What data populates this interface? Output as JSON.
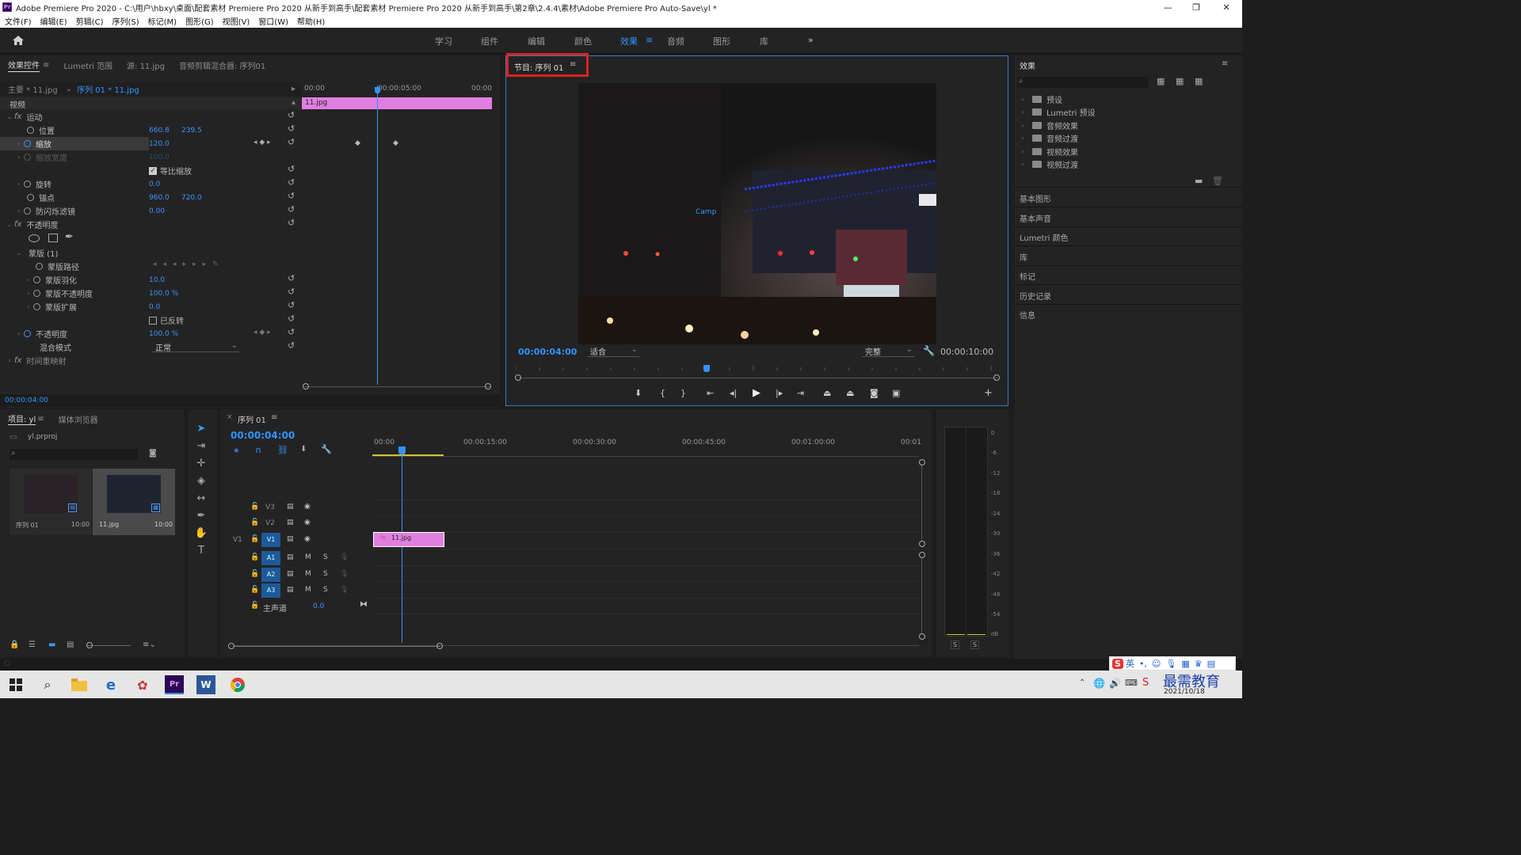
{
  "app": {
    "title": "Adobe Premiere Pro 2020 - C:\\用户\\hbxy\\桌面\\配套素材 Premiere Pro 2020 从新手到高手\\配套素材 Premiere Pro 2020 从新手到高手\\第2章\\2.4.4\\素材\\Adobe Premiere Pro Auto-Save\\yl *",
    "logo": "Pr"
  },
  "menu": [
    "文件(F)",
    "编辑(E)",
    "剪辑(C)",
    "序列(S)",
    "标记(M)",
    "图形(G)",
    "视图(V)",
    "窗口(W)",
    "帮助(H)"
  ],
  "workspaces": [
    "学习",
    "组件",
    "编辑",
    "颜色",
    "效果",
    "音频",
    "图形",
    "库"
  ],
  "workspaces_more": "»",
  "effect_controls": {
    "tabs": [
      "效果控件",
      "Lumetri 范围",
      "源: 11.jpg",
      "音频剪辑混合器: 序列01"
    ],
    "master": "主要 * 11.jpg",
    "sequence_clip": "序列 01 * 11.jpg",
    "ruler": [
      "00:00",
      "00:00:05:00",
      "00:00"
    ],
    "clip_name": "11.jpg",
    "section_video": "视频",
    "motion": "运动",
    "position": {
      "label": "位置",
      "x": "660.8",
      "y": "239.5"
    },
    "scale": {
      "label": "缩放",
      "value": "120.0"
    },
    "scale_width": {
      "label": "缩放宽度",
      "value": "100.0"
    },
    "uniform_scale": "等比缩放",
    "rotation": {
      "label": "旋转",
      "value": "0.0"
    },
    "anchor": {
      "label": "锚点",
      "x": "960.0",
      "y": "720.0"
    },
    "antiflicker": {
      "label": "防闪烁滤镜",
      "value": "0.00"
    },
    "opacity_group": "不透明度",
    "mask": "蒙版 (1)",
    "mask_path": "蒙版路径",
    "mask_feather": {
      "label": "蒙版羽化",
      "value": "10.0"
    },
    "mask_opacity": {
      "label": "蒙版不透明度",
      "value": "100.0 %"
    },
    "mask_expansion": {
      "label": "蒙版扩展",
      "value": "0.0"
    },
    "inverted": "已反转",
    "opacity": {
      "label": "不透明度",
      "value": "100.0 %"
    },
    "blend_mode": {
      "label": "混合模式",
      "value": "正常"
    },
    "time_remap": "时间重映射",
    "timecode": "00:00:04:00"
  },
  "program": {
    "tab": "节目: 序列 01",
    "timecode": "00:00:04:00",
    "fit": "适合",
    "quality": "完整",
    "duration": "00:00:10:00"
  },
  "effects_panel": {
    "title": "效果",
    "search_placeholder": "",
    "items": [
      "预设",
      "Lumetri 预设",
      "音频效果",
      "音频过渡",
      "视频效果",
      "视频过渡"
    ],
    "sections": [
      "基本图形",
      "基本声音",
      "Lumetri 颜色",
      "库",
      "标记",
      "历史记录",
      "信息"
    ]
  },
  "project": {
    "tabs": [
      "项目: yl",
      "媒体浏览器"
    ],
    "file": "yl.prproj",
    "items": [
      {
        "name": "序列 01",
        "duration": "10:00"
      },
      {
        "name": "11.jpg",
        "duration": "10:00"
      }
    ]
  },
  "timeline": {
    "tab": "序列 01",
    "timecode": "00:00:04:00",
    "ruler": [
      "00:00",
      "00:00:15:00",
      "00:00:30:00",
      "00:00:45:00",
      "00:01:00:00",
      "00:01"
    ],
    "video_tracks": [
      "V3",
      "V2",
      "V1"
    ],
    "audio_tracks": [
      "A1",
      "A2",
      "A3"
    ],
    "source_patch_v": "V1",
    "master": {
      "label": "主声道",
      "value": "0.0"
    },
    "clip": "11.jpg",
    "toggles": {
      "m": "M",
      "s": "S"
    }
  },
  "meter": {
    "scale": [
      "0",
      "-6",
      "-12",
      "-18",
      "-24",
      "-30",
      "-36",
      "-42",
      "-48",
      "-54",
      "dB"
    ],
    "solo": [
      "S",
      "S"
    ]
  },
  "taskbar": {
    "time": "2021/10/18",
    "watermark": "最需教育",
    "ime": "英"
  },
  "colors": {
    "accent": "#2f94ff",
    "clip": "#e07fe0",
    "highlight_box": "#e02020"
  }
}
